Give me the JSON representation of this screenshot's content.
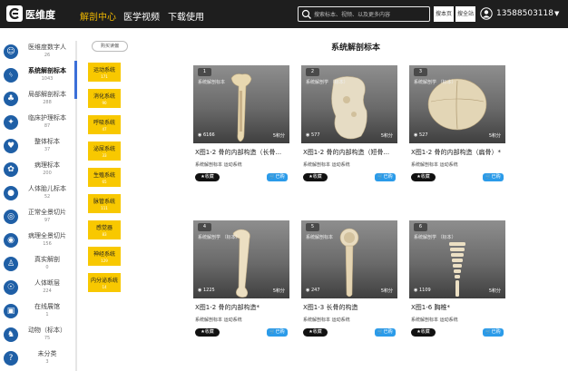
{
  "topbar": {
    "brand": "医维度",
    "nav": [
      "解剖中心",
      "医学视频",
      "下载使用"
    ],
    "search_placeholder": "搜索标本、视频、以及更多内容",
    "search_site_btn": "搜本页",
    "search_all_btn": "搜全站",
    "user": "13588503118"
  },
  "sidebar": {
    "items": [
      {
        "label": "医维度数字人",
        "count": "26",
        "icon": "person-icon"
      },
      {
        "label": "系统解剖标本",
        "count": "1043",
        "icon": "lungs-icon",
        "active": true
      },
      {
        "label": "局部解剖标本",
        "count": "288",
        "icon": "organ-icon"
      },
      {
        "label": "临床护理标本",
        "count": "87",
        "icon": "fish-icon"
      },
      {
        "label": "整体标本",
        "count": "37",
        "icon": "heart-icon"
      },
      {
        "label": "病理标本",
        "count": "200",
        "icon": "cells-icon"
      },
      {
        "label": "人体胎儿标本",
        "count": "52",
        "icon": "fetus-icon"
      },
      {
        "label": "正常全景切片",
        "count": "97",
        "icon": "microscope-icon"
      },
      {
        "label": "病理全景切片",
        "count": "156",
        "icon": "slide-icon"
      },
      {
        "label": "真实解剖",
        "count": "0",
        "icon": "body-icon"
      },
      {
        "label": "人体断层",
        "count": "224",
        "icon": "scan-icon"
      },
      {
        "label": "在线展馆",
        "count": "1",
        "icon": "gallery-icon"
      },
      {
        "label": "动物（标本）",
        "count": "75",
        "icon": "animal-icon"
      },
      {
        "label": "未分类",
        "count": "3",
        "icon": "question-icon"
      }
    ]
  },
  "subcategories": {
    "pill": "购买读偏",
    "items": [
      {
        "name": "运动系统",
        "count": "171"
      },
      {
        "name": "消化系统",
        "count": "90"
      },
      {
        "name": "呼吸系统",
        "count": "47"
      },
      {
        "name": "泌尿系统",
        "count": "33"
      },
      {
        "name": "生殖系统",
        "count": "65"
      },
      {
        "name": "脉管系统",
        "count": "111"
      },
      {
        "name": "感觉器",
        "count": "83"
      },
      {
        "name": "神经系统",
        "count": "129"
      },
      {
        "name": "内分泌系统",
        "count": "14"
      }
    ]
  },
  "main": {
    "title": "系统解剖标本",
    "cards": [
      {
        "num": "1",
        "watermark": "系统解剖标本",
        "views": "6166",
        "points": "5积分",
        "title": "X图1-2 骨的内部构造（长骨...",
        "tags": "系统解剖标本  运动系统",
        "fav": "收藏",
        "buy": "已购"
      },
      {
        "num": "2",
        "watermark": "系统解剖学 （标本）",
        "views": "577",
        "points": "5积分",
        "title": "X图1-2 骨的内部构造（短骨...",
        "tags": "系统解剖标本  运动系统",
        "fav": "收藏",
        "buy": "已购"
      },
      {
        "num": "3",
        "watermark": "系统解剖学 （标本）",
        "views": "527",
        "points": "5积分",
        "title": "X图1-2 骨的内部构造（扁骨）*",
        "tags": "系统解剖标本  运动系统",
        "fav": "收藏",
        "buy": "已购"
      },
      {
        "num": "4",
        "watermark": "系统解剖学 （标本）",
        "views": "1225",
        "points": "5积分",
        "title": "X图1-2 骨的内部构造*",
        "tags": "系统解剖标本  运动系统",
        "fav": "收藏",
        "buy": "已购"
      },
      {
        "num": "5",
        "watermark": "系统解剖标本",
        "views": "247",
        "points": "5积分",
        "title": "X图1-3 长骨的构造",
        "tags": "系统解剖标本  运动系统",
        "fav": "收藏",
        "buy": "已购"
      },
      {
        "num": "6",
        "watermark": "系统解剖学 （标本）",
        "views": "1109",
        "points": "5积分",
        "title": "X图1-6 胸椎*",
        "tags": "系统解剖标本  运动系统",
        "fav": "收藏",
        "buy": "已购"
      }
    ]
  },
  "colors": {
    "topbar": "#1e1e1e",
    "nav_active": "#f0b800",
    "category": "#f8c800",
    "sidebar_icon": "#1f5fa6",
    "buy": "#2b9be9"
  }
}
